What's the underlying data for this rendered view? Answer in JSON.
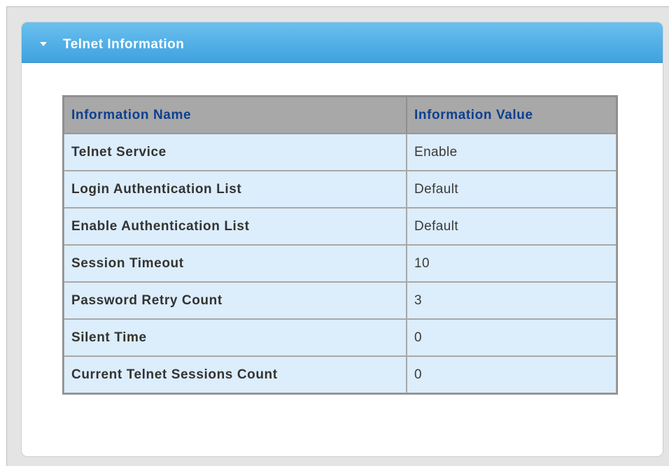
{
  "panel": {
    "title": "Telnet Information",
    "collapse_icon": "triangle-down-icon"
  },
  "table": {
    "headers": {
      "name": "Information Name",
      "value": "Information Value"
    },
    "rows": [
      {
        "name": "Telnet Service",
        "value": "Enable"
      },
      {
        "name": "Login Authentication List",
        "value": "Default"
      },
      {
        "name": "Enable Authentication List",
        "value": "Default"
      },
      {
        "name": "Session Timeout",
        "value": "10"
      },
      {
        "name": "Password Retry Count",
        "value": "3"
      },
      {
        "name": "Silent Time",
        "value": "0"
      },
      {
        "name": "Current Telnet Sessions Count",
        "value": "0"
      }
    ]
  },
  "colors": {
    "header_gradient_top": "#6cc0ee",
    "header_gradient_bottom": "#40a2de",
    "table_header_bg": "#a8a8a8",
    "table_header_text": "#0d3f8f",
    "table_cell_bg": "#dcedfb"
  }
}
